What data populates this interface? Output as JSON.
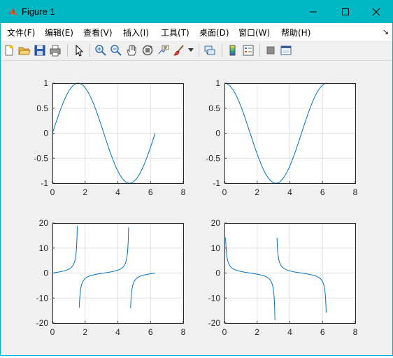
{
  "window": {
    "title": "Figure 1",
    "accent": "#00b8c4"
  },
  "menu": [
    {
      "label": "文件(F)"
    },
    {
      "label": "编辑(E)"
    },
    {
      "label": "查看(V)"
    },
    {
      "label": "插入(I)"
    },
    {
      "label": "工具(T)"
    },
    {
      "label": "桌面(D)"
    },
    {
      "label": "窗口(W)"
    },
    {
      "label": "帮助(H)"
    }
  ],
  "toolbar": [
    "new-figure-icon",
    "open-file-icon",
    "save-icon",
    "print-icon",
    "edit-plot-icon",
    "zoom-in-icon",
    "zoom-out-icon",
    "pan-icon",
    "rotate-3d-icon",
    "data-cursor-icon",
    "brush-icon",
    "link-plot-icon",
    "colorbar-icon",
    "legend-icon",
    "hide-tools-icon",
    "dock-icon"
  ],
  "chart_data": [
    {
      "type": "line",
      "function": "sin",
      "x_range": [
        0,
        6.28
      ],
      "xlim": [
        0,
        8
      ],
      "ylim": [
        -1,
        1
      ],
      "xticks": [
        "0",
        "2",
        "4",
        "6",
        "8"
      ],
      "yticks": [
        "1",
        "0.5",
        "0",
        "-0.5",
        "-1"
      ],
      "color": "#0072bd",
      "grid": true
    },
    {
      "type": "line",
      "function": "cos",
      "x_range": [
        0,
        6.28
      ],
      "xlim": [
        0,
        8
      ],
      "ylim": [
        -1,
        1
      ],
      "xticks": [
        "0",
        "2",
        "4",
        "6",
        "8"
      ],
      "yticks": [
        "1",
        "0.5",
        "0",
        "-0.5",
        "-1"
      ],
      "color": "#0072bd",
      "grid": true
    },
    {
      "type": "line",
      "function": "tan",
      "x_range": [
        0,
        6.28
      ],
      "xlim": [
        0,
        8
      ],
      "ylim": [
        -20,
        20
      ],
      "xticks": [
        "0",
        "2",
        "4",
        "6",
        "8"
      ],
      "yticks": [
        "20",
        "10",
        "0",
        "-10",
        "-20"
      ],
      "color": "#0072bd",
      "grid": true
    },
    {
      "type": "line",
      "function": "cot",
      "x_range": [
        0.06,
        6.22
      ],
      "xlim": [
        0,
        8
      ],
      "ylim": [
        -20,
        20
      ],
      "xticks": [
        "0",
        "2",
        "4",
        "6",
        "8"
      ],
      "yticks": [
        "20",
        "10",
        "0",
        "-10",
        "-20"
      ],
      "color": "#0072bd",
      "grid": true
    }
  ]
}
